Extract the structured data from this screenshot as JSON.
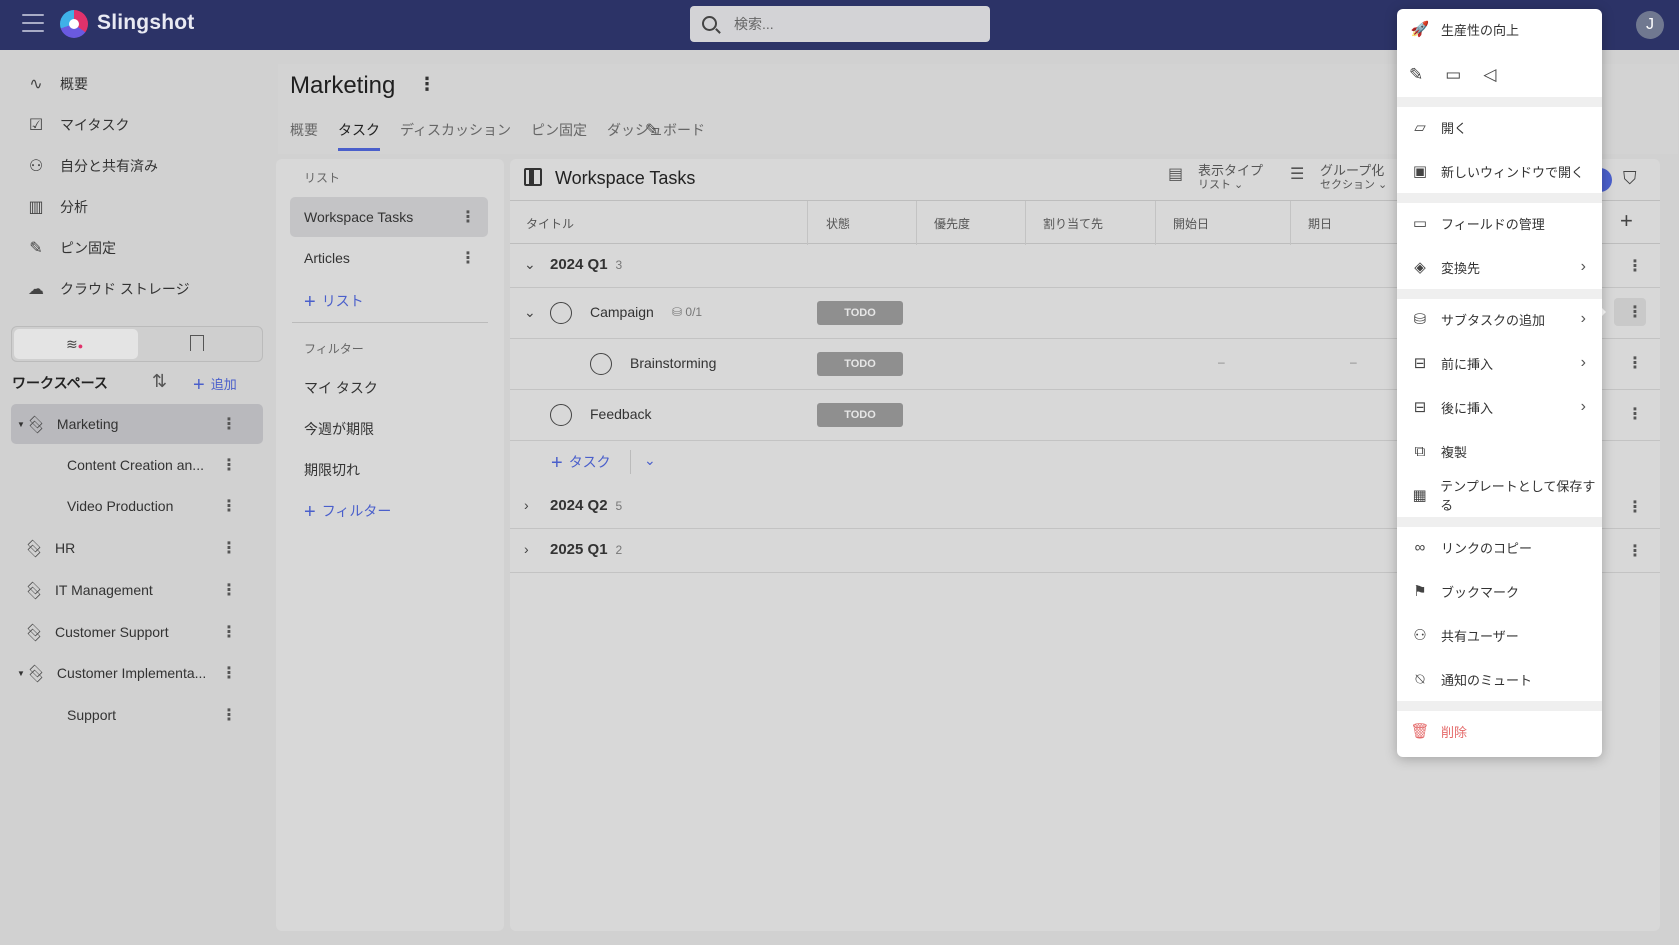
{
  "app": {
    "name": "Slingshot"
  },
  "search": {
    "placeholder": "検索..."
  },
  "user": {
    "initial": "J"
  },
  "nav": {
    "items": [
      {
        "label": "概要",
        "icon": "activity-icon"
      },
      {
        "label": "マイタスク",
        "icon": "checklist-icon"
      },
      {
        "label": "自分と共有済み",
        "icon": "shared-user-icon"
      },
      {
        "label": "分析",
        "icon": "bar-chart-icon"
      },
      {
        "label": "ピン固定",
        "icon": "pin-icon"
      },
      {
        "label": "クラウド ストレージ",
        "icon": "cloud-icon"
      }
    ]
  },
  "workspaces": {
    "heading": "ワークスペース",
    "add_label": "追加",
    "items": [
      {
        "label": "Marketing"
      },
      {
        "label": "Content Creation an..."
      },
      {
        "label": "Video Production"
      },
      {
        "label": "HR"
      },
      {
        "label": "IT Management"
      },
      {
        "label": "Customer Support"
      },
      {
        "label": "Customer Implementa..."
      },
      {
        "label": "Support"
      }
    ]
  },
  "page": {
    "title": "Marketing",
    "tabs": [
      "概要",
      "タスク",
      "ディスカッション",
      "ピン固定",
      "ダッシュボード"
    ]
  },
  "lists": {
    "label": "リスト",
    "items": [
      "Workspace Tasks",
      "Articles"
    ],
    "add_label": "リスト",
    "filters_label": "フィルター",
    "filters": [
      "マイ タスク",
      "今週が期限",
      "期限切れ"
    ],
    "add_filter_label": "フィルター"
  },
  "tasks": {
    "title": "Workspace Tasks",
    "view_type": {
      "label": "表示タイプ",
      "value": "リスト"
    },
    "group_by": {
      "label": "グループ化",
      "value": "セクション"
    },
    "columns": [
      "タイトル",
      "状態",
      "優先度",
      "割り当て先",
      "開始日",
      "期日"
    ],
    "groups": [
      {
        "label": "2024 Q1",
        "count": "3"
      },
      {
        "label": "2024 Q2",
        "count": "5"
      },
      {
        "label": "2025 Q1",
        "count": "2"
      }
    ],
    "rows": [
      {
        "name": "Campaign",
        "subtasks": "0/1",
        "status": "TODO"
      },
      {
        "name": "Brainstorming",
        "status": "TODO",
        "start": "–",
        "due": "–"
      },
      {
        "name": "Feedback",
        "status": "TODO"
      }
    ],
    "add_task_label": "タスク"
  },
  "menu": {
    "items": [
      {
        "label": "生産性の向上",
        "icon": "rocket-icon"
      },
      {
        "label": "開く",
        "icon": "folder-icon"
      },
      {
        "label": "新しいウィンドウで開く",
        "icon": "window-icon"
      },
      {
        "label": "フィールドの管理",
        "icon": "manage-fields-icon"
      },
      {
        "label": "変換先",
        "icon": "convert-icon"
      },
      {
        "label": "サブタスクの追加",
        "icon": "subtask-icon"
      },
      {
        "label": "前に挿入",
        "icon": "insert-before-icon"
      },
      {
        "label": "後に挿入",
        "icon": "insert-after-icon"
      },
      {
        "label": "複製",
        "icon": "duplicate-icon"
      },
      {
        "label": "テンプレートとして保存する",
        "icon": "template-icon"
      },
      {
        "label": "リンクのコピー",
        "icon": "link-icon"
      },
      {
        "label": "ブックマーク",
        "icon": "bookmark-icon"
      },
      {
        "label": "共有ユーザー",
        "icon": "add-user-icon"
      },
      {
        "label": "通知のミュート",
        "icon": "bell-off-icon"
      },
      {
        "label": "削除",
        "icon": "trash-icon"
      }
    ],
    "danger_color": "#e46a6a"
  },
  "colors": {
    "topbar": "#2c3367",
    "accent": "#4a5fcb",
    "todo_badge": "#8f8f8f"
  }
}
